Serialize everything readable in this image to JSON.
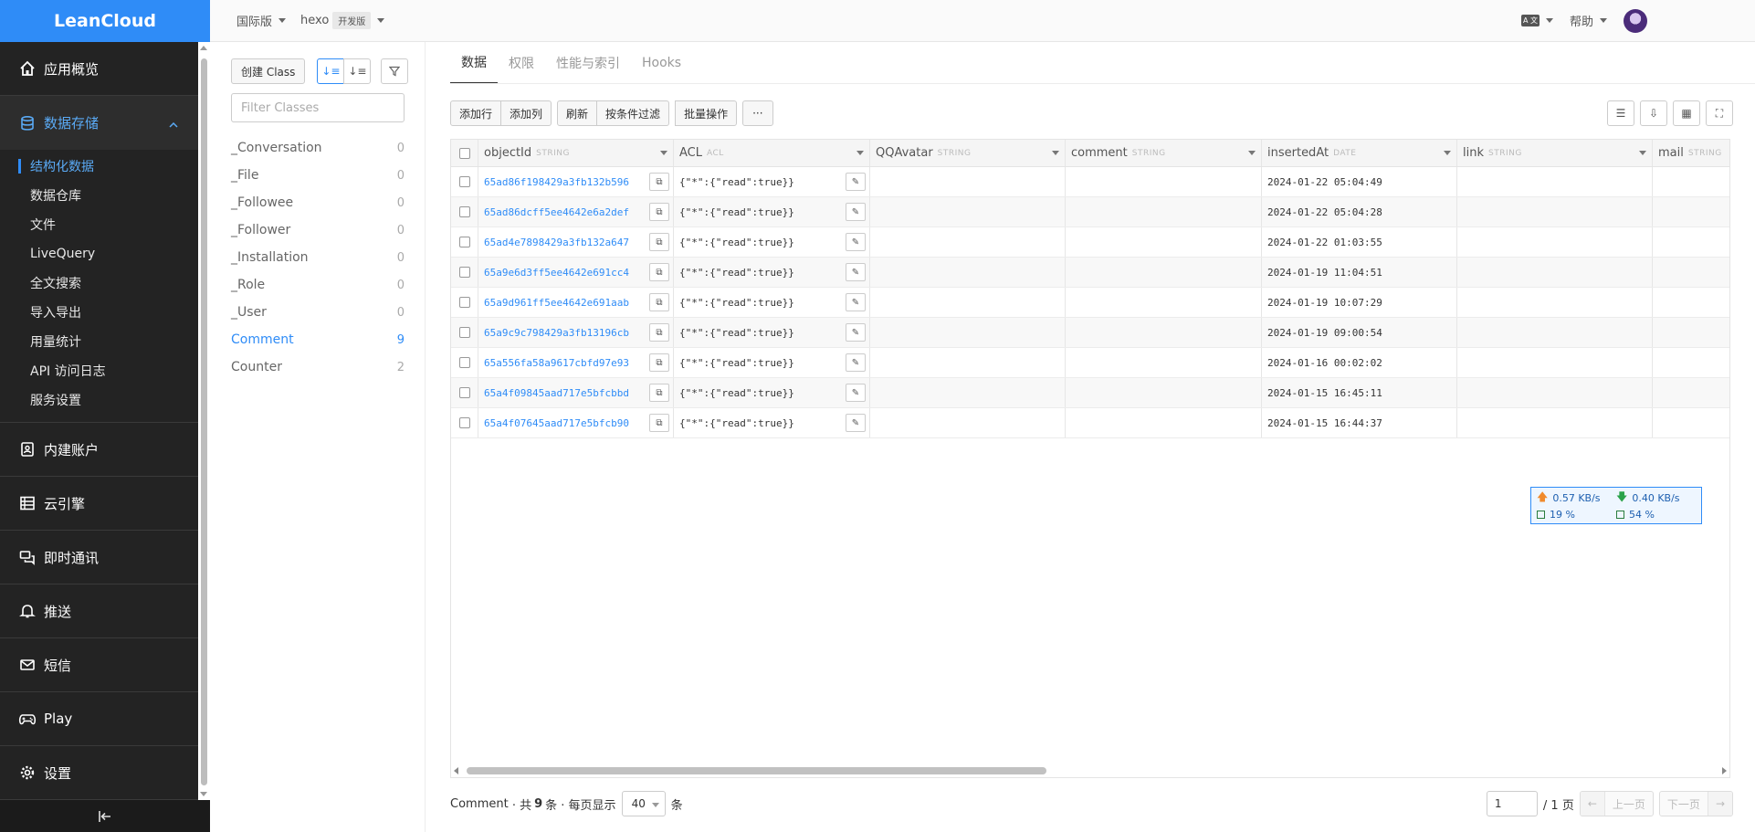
{
  "app": {
    "logo": "LeanCloud"
  },
  "topbar": {
    "region": "国际版",
    "app_name": "hexo",
    "env_badge": "开发版",
    "lang_label": "A 文",
    "help": "帮助"
  },
  "sidebar": {
    "items": [
      {
        "label": "应用概览",
        "icon": "home-icon"
      },
      {
        "label": "数据存储",
        "icon": "database-icon"
      },
      {
        "label": "内建账户",
        "icon": "user-card-icon"
      },
      {
        "label": "云引擎",
        "icon": "server-icon"
      },
      {
        "label": "即时通讯",
        "icon": "chat-icon"
      },
      {
        "label": "推送",
        "icon": "bell-icon"
      },
      {
        "label": "短信",
        "icon": "mail-icon"
      },
      {
        "label": "Play",
        "icon": "gamepad-icon"
      },
      {
        "label": "设置",
        "icon": "gear-icon"
      }
    ],
    "sub_items": [
      "结构化数据",
      "数据仓库",
      "文件",
      "LiveQuery",
      "全文搜索",
      "导入导出",
      "用量统计",
      "API 访问日志",
      "服务设置"
    ]
  },
  "classes": {
    "create_label": "创建 Class",
    "filter_placeholder": "Filter Classes",
    "list": [
      {
        "name": "_Conversation",
        "count": "0"
      },
      {
        "name": "_File",
        "count": "0"
      },
      {
        "name": "_Followee",
        "count": "0"
      },
      {
        "name": "_Follower",
        "count": "0"
      },
      {
        "name": "_Installation",
        "count": "0"
      },
      {
        "name": "_Role",
        "count": "0"
      },
      {
        "name": "_User",
        "count": "0"
      },
      {
        "name": "Comment",
        "count": "9"
      },
      {
        "name": "Counter",
        "count": "2"
      }
    ]
  },
  "tabs": [
    "数据",
    "权限",
    "性能与索引",
    "Hooks"
  ],
  "actions": {
    "add_row": "添加行",
    "add_col": "添加列",
    "refresh": "刷新",
    "filter": "按条件过滤",
    "batch": "批量操作",
    "more": "···"
  },
  "columns": [
    {
      "name": "objectId",
      "type": "STRING"
    },
    {
      "name": "ACL",
      "type": "ACL"
    },
    {
      "name": "QQAvatar",
      "type": "STRING"
    },
    {
      "name": "comment",
      "type": "STRING"
    },
    {
      "name": "insertedAt",
      "type": "DATE"
    },
    {
      "name": "link",
      "type": "STRING"
    },
    {
      "name": "mail",
      "type": "STRING"
    }
  ],
  "rows": [
    {
      "id": "65ad86f198429a3fb132b596",
      "acl": "{\"*\":{\"read\":true}}",
      "inserted": "2024-01-22 05:04:49"
    },
    {
      "id": "65ad86dcff5ee4642e6a2def",
      "acl": "{\"*\":{\"read\":true}}",
      "inserted": "2024-01-22 05:04:28"
    },
    {
      "id": "65ad4e7898429a3fb132a647",
      "acl": "{\"*\":{\"read\":true}}",
      "inserted": "2024-01-22 01:03:55"
    },
    {
      "id": "65a9e6d3ff5ee4642e691cc4",
      "acl": "{\"*\":{\"read\":true}}",
      "inserted": "2024-01-19 11:04:51"
    },
    {
      "id": "65a9d961ff5ee4642e691aab",
      "acl": "{\"*\":{\"read\":true}}",
      "inserted": "2024-01-19 10:07:29"
    },
    {
      "id": "65a9c9c798429a3fb13196cb",
      "acl": "{\"*\":{\"read\":true}}",
      "inserted": "2024-01-19 09:00:54"
    },
    {
      "id": "65a556fa58a9617cbfd97e93",
      "acl": "{\"*\":{\"read\":true}}",
      "inserted": "2024-01-16 00:02:02"
    },
    {
      "id": "65a4f09845aad717e5bfcbbd",
      "acl": "{\"*\":{\"read\":true}}",
      "inserted": "2024-01-15 16:45:11"
    },
    {
      "id": "65a4f07645aad717e5bfcb90",
      "acl": "{\"*\":{\"read\":true}}",
      "inserted": "2024-01-15 16:44:37"
    }
  ],
  "netmon": {
    "up": "0.57 KB/s",
    "down": "0.40 KB/s",
    "cpu": "19 %",
    "mem": "54 %"
  },
  "footer": {
    "class_name": "Comment",
    "total_prefix": "· 共",
    "total": "9",
    "total_suffix": "条 · 每页显示",
    "per_page": "40",
    "per_page_suffix": "条",
    "page": "1",
    "pages": "/ 1 页",
    "prev": "上一页",
    "next": "下一页"
  },
  "colors": {
    "brand": "#2f8cf7",
    "nav_bg": "#232323",
    "link": "#2f8cf7"
  }
}
